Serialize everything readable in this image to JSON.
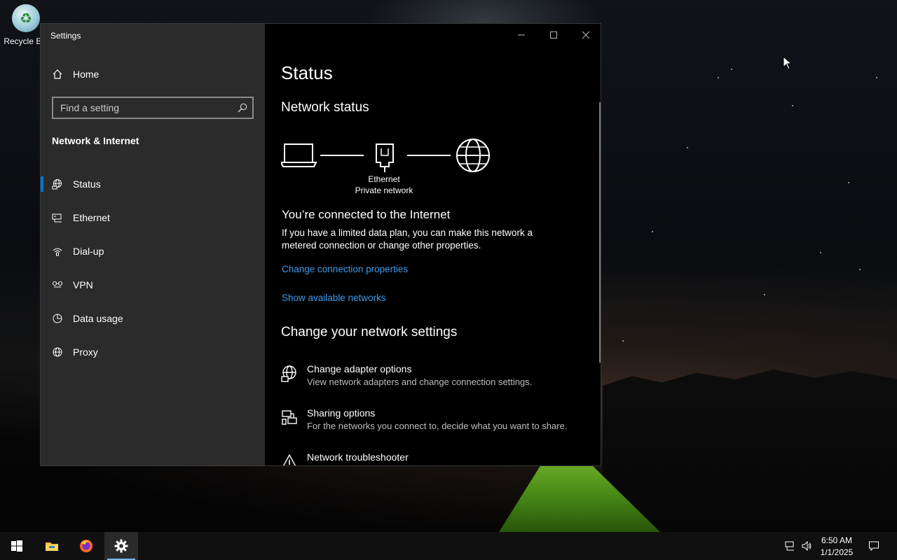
{
  "desktop": {
    "recycle_bin_label": "Recycle Bin"
  },
  "window": {
    "title": "Settings",
    "home_label": "Home",
    "search_placeholder": "Find a setting",
    "section_title": "Network & Internet",
    "nav": [
      {
        "label": "Status",
        "icon": "status-globe-icon",
        "active": true
      },
      {
        "label": "Ethernet",
        "icon": "ethernet-icon",
        "active": false
      },
      {
        "label": "Dial-up",
        "icon": "dialup-icon",
        "active": false
      },
      {
        "label": "VPN",
        "icon": "vpn-icon",
        "active": false
      },
      {
        "label": "Data usage",
        "icon": "pie-chart-icon",
        "active": false
      },
      {
        "label": "Proxy",
        "icon": "globe-icon",
        "active": false
      }
    ]
  },
  "main": {
    "page_title": "Status",
    "network_status_heading": "Network status",
    "connection_name": "Ethernet",
    "connection_type": "Private network",
    "connected_heading": "You’re connected to the Internet",
    "connected_desc": "If you have a limited data plan, you can make this network a metered connection or change other properties.",
    "link_change_properties": "Change connection properties",
    "link_show_networks": "Show available networks",
    "change_settings_heading": "Change your network settings",
    "options": [
      {
        "title": "Change adapter options",
        "subtitle": "View network adapters and change connection settings.",
        "icon": "adapter-icon"
      },
      {
        "title": "Sharing options",
        "subtitle": "For the networks you connect to, decide what you want to share.",
        "icon": "sharing-icon"
      },
      {
        "title": "Network troubleshooter",
        "subtitle": "",
        "icon": "warning-icon"
      }
    ]
  },
  "taskbar": {
    "time": "6:50 AM",
    "date": "1/1/2025"
  },
  "colors": {
    "accent": "#0078d7",
    "link": "#3f9ae8",
    "sidebar_bg": "#2b2b2b"
  }
}
